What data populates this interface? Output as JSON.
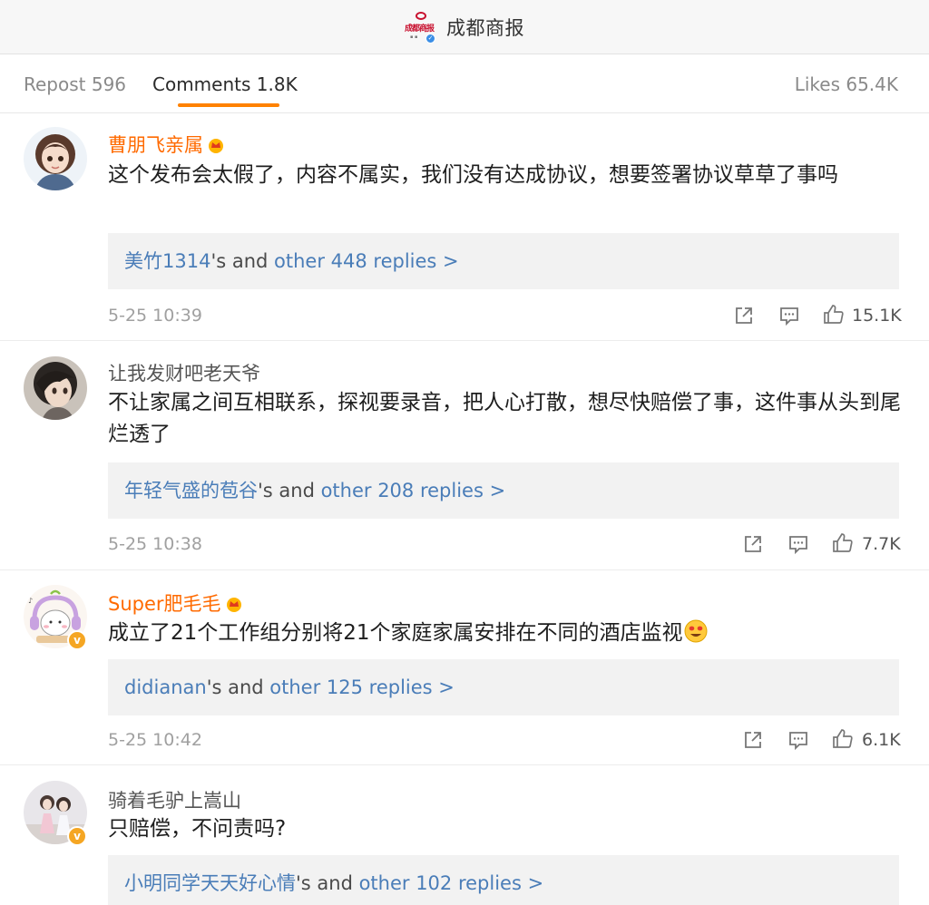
{
  "header": {
    "logo_text": "成都商报",
    "account_name": "成都商报"
  },
  "tabs": {
    "repost": "Repost 596",
    "comments": "Comments 1.8K",
    "likes": "Likes 65.4K"
  },
  "colors": {
    "accent": "#ff8200",
    "vip_name": "#ff6a00",
    "link_blue": "#4a7db8",
    "verified_badge": "#f5a623"
  },
  "comments": [
    {
      "username": "曹朋飞亲属",
      "text": "这个发布会太假了，内容不属实，我们没有达成协议，想要签署协议草草了事吗",
      "reply_user": "美竹1314",
      "reply_mid": "'s and ",
      "reply_more": "other 448 replies >",
      "time": "5-25 10:39",
      "likes": "15.1K"
    },
    {
      "username": "让我发财吧老天爷",
      "text": "不让家属之间互相联系，探视要录音，把人心打散，想尽快赔偿了事，这件事从头到尾烂透了",
      "reply_user": "年轻气盛的苞谷",
      "reply_mid": "'s and ",
      "reply_more": "other 208 replies >",
      "time": "5-25 10:38",
      "likes": "7.7K"
    },
    {
      "username": "Super肥毛毛",
      "text": "成立了21个工作组分别将21个家庭家属安排在不同的酒店监视",
      "reply_user": "didianan",
      "reply_mid": "'s and ",
      "reply_more": "other 125 replies >",
      "time": "5-25 10:42",
      "likes": "6.1K"
    },
    {
      "username": "骑着毛驴上嵩山",
      "text": "只赔偿，不问责吗?",
      "reply_user": "小明同学天天好心情",
      "reply_mid": "'s and ",
      "reply_more": "other 102 replies >"
    }
  ]
}
